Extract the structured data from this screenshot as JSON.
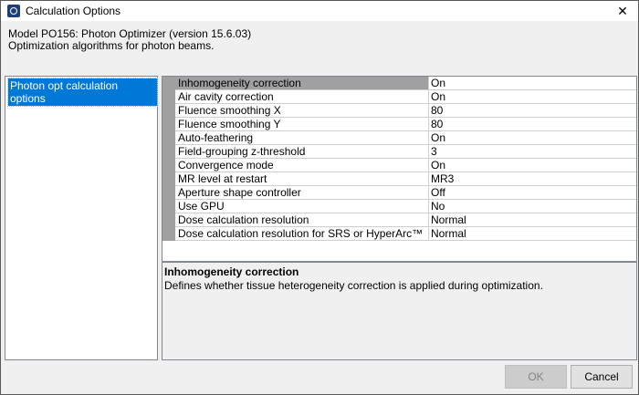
{
  "window": {
    "title": "Calculation Options",
    "close_glyph": "✕"
  },
  "header": {
    "model_line": "Model PO156: Photon Optimizer (version 15.6.03)",
    "description_line": "Optimization algorithms for photon beams."
  },
  "left_panel": {
    "items": [
      {
        "label": "Photon opt calculation options"
      }
    ]
  },
  "grid": {
    "rows": [
      {
        "name": "Inhomogeneity correction",
        "value": "On"
      },
      {
        "name": "Air cavity correction",
        "value": "On"
      },
      {
        "name": "Fluence smoothing X",
        "value": "80"
      },
      {
        "name": "Fluence smoothing Y",
        "value": "80"
      },
      {
        "name": "Auto-feathering",
        "value": "On"
      },
      {
        "name": "Field-grouping z-threshold",
        "value": "3"
      },
      {
        "name": "Convergence mode",
        "value": "On"
      },
      {
        "name": "MR level at restart",
        "value": "MR3"
      },
      {
        "name": "Aperture shape controller",
        "value": "Off"
      },
      {
        "name": "Use GPU",
        "value": "No"
      },
      {
        "name": "Dose calculation resolution",
        "value": "Normal"
      },
      {
        "name": "Dose calculation resolution for SRS or HyperArc™",
        "value": "Normal"
      }
    ]
  },
  "description": {
    "title": "Inhomogeneity correction",
    "text": "Defines whether tissue heterogeneity correction is applied during optimization."
  },
  "buttons": {
    "ok": "OK",
    "cancel": "Cancel"
  },
  "colors": {
    "selection_blue": "#0078d7",
    "selected_row_gray": "#a0a0a0"
  },
  "icons": {
    "app": "app-icon",
    "close": "close-icon"
  }
}
